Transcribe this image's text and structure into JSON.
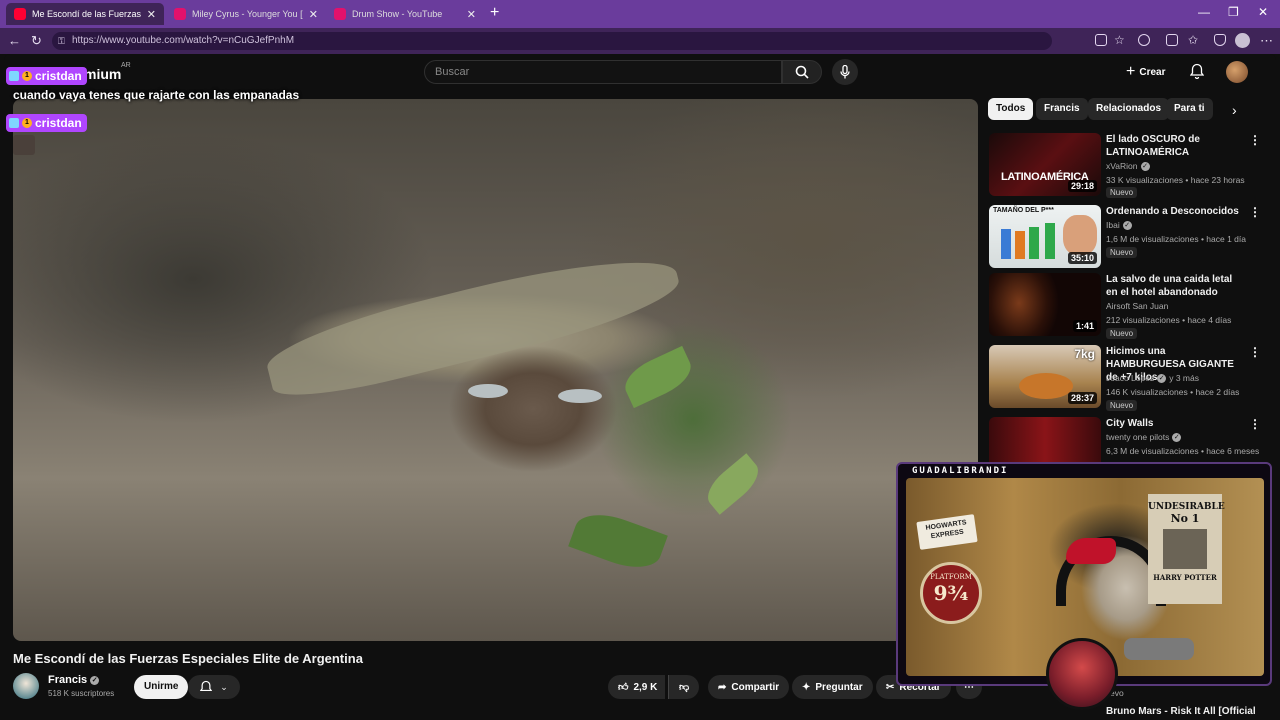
{
  "browser": {
    "tabs": [
      {
        "title": "Me Escondí de las Fuerzas Especiales",
        "favicon": "youtube-icon",
        "active": true
      },
      {
        "title": "Miley Cyrus - Younger You [From",
        "favicon": "youtube-icon",
        "active": false
      },
      {
        "title": "Drum Show - YouTube",
        "favicon": "youtube-icon",
        "active": false
      }
    ],
    "url": "https://www.youtube.com/watch?v=nCuGJefPnhM",
    "theme_color": "#6a3c9c"
  },
  "youtube": {
    "logo_text": "mium",
    "logo_region": "AR",
    "search_placeholder": "Buscar",
    "create_label": "Crear",
    "chips": [
      "Todos",
      "Francis",
      "Relacionados",
      "Para ti"
    ],
    "video": {
      "title": "Me Escondí de las Fuerzas Especiales Elite de Argentina",
      "channel": "Francis",
      "subscribers": "518 K suscriptores",
      "join_label": "Unirme",
      "likes": "2,9 K",
      "share_label": "Compartir",
      "ask_label": "Preguntar",
      "clip_label": "Recortar"
    },
    "recommendations": [
      {
        "title": "El lado OSCURO de LATINOAMÉRICA",
        "channel": "xVaRion",
        "verified": true,
        "meta": "33 K visualizaciones • hace 23 horas",
        "badge": "Nuevo",
        "duration": "29:18",
        "thumb_text": "LATINOAMÉRICA"
      },
      {
        "title": "Ordenando a Desconocidos",
        "channel": "Ibai",
        "verified": true,
        "meta": "1,6 M de visualizaciones • hace 1 día",
        "badge": "Nuevo",
        "duration": "35:10",
        "thumb_text": "TAMAÑO DEL P***"
      },
      {
        "title": "La salvo de una caida letal en el hotel abandonado",
        "channel": "Airsoft San Juan",
        "verified": false,
        "meta": "212 visualizaciones • hace 4 días",
        "badge": "Nuevo",
        "duration": "1:41",
        "thumb_text": ""
      },
      {
        "title": "Hicimos una HAMBURGUESA GIGANTE de +7 kilos",
        "channel": "Joaco Lopez",
        "verified": true,
        "channel_suffix": "y 3 más",
        "meta": "146 K visualizaciones • hace 2 días",
        "badge": "Nuevo",
        "duration": "28:37",
        "thumb_text": "7kg"
      },
      {
        "title": "City Walls",
        "channel": "twenty one pilots",
        "verified": true,
        "meta": "6,3 M de visualizaciones • hace 6 meses",
        "badge": "",
        "duration": "",
        "thumb_text": ""
      }
    ],
    "partial_rec": {
      "title": "Bruno Mars - Risk It All [Official",
      "channel_fragment": "evo"
    }
  },
  "stream_overlay": {
    "chat_user": "cristdan",
    "chat_user_badge": "1",
    "chat_message": "cuando vaya tenes que rajarte con las empanadas",
    "chat_user_2": "cristdan",
    "chat_user_2_badge": "1",
    "chat_badge_color": "#b046ff",
    "streamer_name": "GUADALIBRANDI",
    "cam_sticker": "HOGWARTS EXPRESS",
    "cam_poster_top": "PLATFORM",
    "cam_poster_number": "9¾",
    "wanted_line1": "UNDESIRABLE",
    "wanted_line2": "No 1",
    "wanted_name": "HARRY POTTER"
  }
}
